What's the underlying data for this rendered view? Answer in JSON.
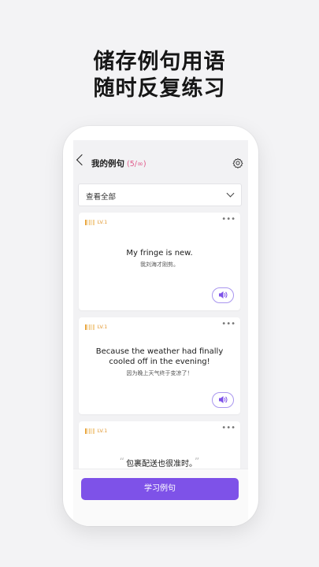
{
  "headline": {
    "line1": "储存例句用语",
    "line2": "随时反复练习"
  },
  "header": {
    "title": "我的例句",
    "count": "(5/∞)",
    "back_icon": "chevron-left-icon",
    "settings_icon": "gear-icon"
  },
  "filter": {
    "selected": "查看全部"
  },
  "cards": [
    {
      "level": "LV.1",
      "english": "My fringe is new.",
      "chinese": "我刘海才刚剪。"
    },
    {
      "level": "LV.1",
      "english": "Because the weather had finally cooled off in the evening!",
      "chinese": "因为晚上天气终于变凉了！"
    },
    {
      "level": "LV.1",
      "chinese": "包裹配送也很准时。"
    }
  ],
  "more_label": "•••",
  "study_button": "学习例句",
  "colors": {
    "accent": "#7e52e8",
    "level": "#e9a53c",
    "count": "#e05a8a"
  }
}
